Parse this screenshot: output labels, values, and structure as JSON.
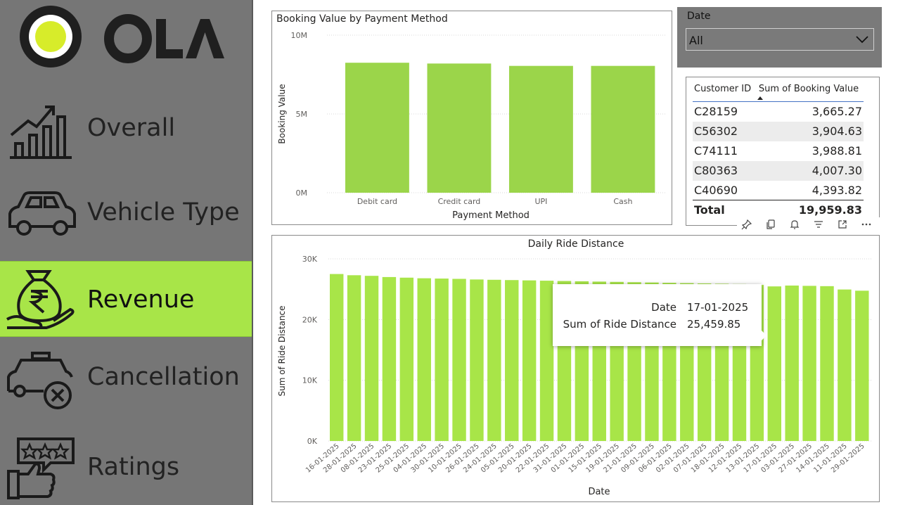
{
  "brand": {
    "name": "OLA",
    "accent": "#a8e548",
    "logo_ring": "#1f1f1f",
    "logo_dot": "#d7ec2a"
  },
  "nav": [
    {
      "label": "Overall",
      "icon": "growth-chart-icon",
      "active": false
    },
    {
      "label": "Vehicle Type",
      "icon": "car-icon",
      "active": false
    },
    {
      "label": "Revenue",
      "icon": "money-bag-rupee-icon",
      "active": true
    },
    {
      "label": "Cancellation",
      "icon": "taxi-cancel-icon",
      "active": false
    },
    {
      "label": "Ratings",
      "icon": "thumbs-up-stars-icon",
      "active": false
    }
  ],
  "slicer": {
    "title": "Date",
    "value": "All"
  },
  "table": {
    "columns": [
      "Customer ID",
      "Sum of Booking Value"
    ],
    "rows": [
      [
        "C28159",
        "3,665.27"
      ],
      [
        "C56302",
        "3,904.63"
      ],
      [
        "C74111",
        "3,988.81"
      ],
      [
        "C80363",
        "4,007.30"
      ],
      [
        "C40690",
        "4,393.82"
      ]
    ],
    "total_label": "Total",
    "total_value": "19,959.83"
  },
  "toolbar": {
    "icons": [
      "pin-icon",
      "copy-icon",
      "bell-icon",
      "filter-icon",
      "focus-mode-icon",
      "more-options-icon"
    ]
  },
  "tooltip": {
    "date_label": "Date",
    "date_value": "17-01-2025",
    "metric_label": "Sum of Ride Distance",
    "metric_value": "25,459.85"
  },
  "chart_data": [
    {
      "type": "bar",
      "title": "Booking Value by Payment Method",
      "xlabel": "Payment Method",
      "ylabel": "Booking Value",
      "categories": [
        "Debit card",
        "Credit card",
        "UPI",
        "Cash"
      ],
      "values": [
        8250000,
        8200000,
        8050000,
        8050000
      ],
      "ylim": [
        0,
        10000000
      ],
      "yticks": [
        0,
        5000000,
        10000000
      ],
      "ytick_labels": [
        "0M",
        "5M",
        "10M"
      ],
      "grid": true,
      "color": "#9bd54a"
    },
    {
      "type": "bar",
      "title": "Daily Ride Distance",
      "xlabel": "Date",
      "ylabel": "Sum of Ride Distance",
      "categories": [
        "16-01-2025",
        "28-01-2025",
        "08-01-2025",
        "23-01-2025",
        "25-01-2025",
        "04-01-2025",
        "30-01-2025",
        "10-01-2025",
        "26-01-2025",
        "24-01-2025",
        "05-01-2025",
        "20-01-2025",
        "22-01-2025",
        "31-01-2025",
        "01-01-2025",
        "15-01-2025",
        "19-01-2025",
        "21-01-2025",
        "09-01-2025",
        "06-01-2025",
        "02-01-2025",
        "07-01-2025",
        "18-01-2025",
        "12-01-2025",
        "13-01-2025",
        "17-01-2025",
        "03-01-2025",
        "27-01-2025",
        "14-01-2025",
        "11-01-2025",
        "29-01-2025"
      ],
      "values": [
        27500,
        27300,
        27200,
        27000,
        26900,
        26800,
        26750,
        26700,
        26600,
        26550,
        26500,
        26450,
        26400,
        26350,
        26300,
        26250,
        26200,
        26150,
        26100,
        26050,
        26000,
        25950,
        25900,
        25850,
        25700,
        25459.85,
        25600,
        25550,
        25500,
        24950,
        24750
      ],
      "ylim": [
        0,
        30000
      ],
      "yticks": [
        0,
        10000,
        20000,
        30000
      ],
      "ytick_labels": [
        "0K",
        "10K",
        "20K",
        "30K"
      ],
      "grid": true,
      "color": "#a8e548"
    }
  ]
}
